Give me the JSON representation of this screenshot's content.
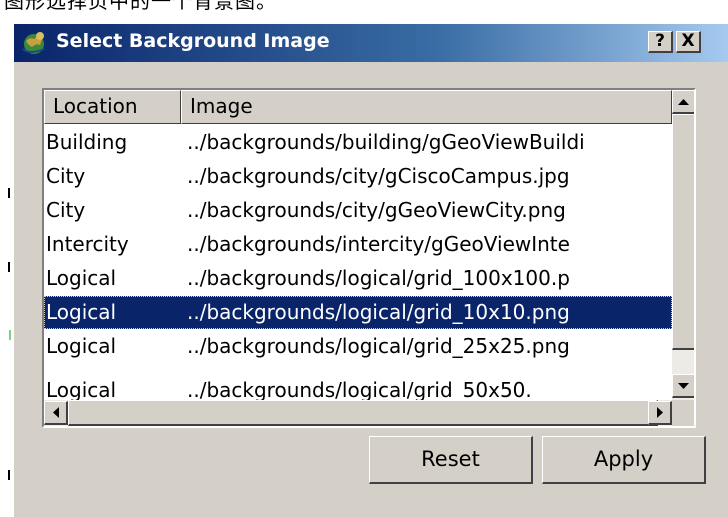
{
  "dialog": {
    "title": "Select Background Image",
    "help_label": "?",
    "close_label": "X"
  },
  "table": {
    "columns": [
      "Location",
      "Image"
    ],
    "rows": [
      {
        "location": "Building",
        "image": "../backgrounds/building/gGeoViewBuildi"
      },
      {
        "location": "City",
        "image": "../backgrounds/city/gCiscoCampus.jpg"
      },
      {
        "location": "City",
        "image": "../backgrounds/city/gGeoViewCity.png"
      },
      {
        "location": "Intercity",
        "image": "../backgrounds/intercity/gGeoViewInte"
      },
      {
        "location": "Logical",
        "image": "../backgrounds/logical/grid_100x100.p"
      },
      {
        "location": "Logical",
        "image": "../backgrounds/logical/grid_10x10.png"
      },
      {
        "location": "Logical",
        "image": "../backgrounds/logical/grid_25x25.png"
      },
      {
        "location": "Logical",
        "image": "../backgrounds/logical/grid_50x50."
      }
    ],
    "selected_index": 5
  },
  "buttons": {
    "reset": "Reset",
    "apply": "Apply"
  },
  "colors": {
    "title_bar": "#0a246a",
    "selection": "#0a246a",
    "face": "#d4d0c8"
  }
}
